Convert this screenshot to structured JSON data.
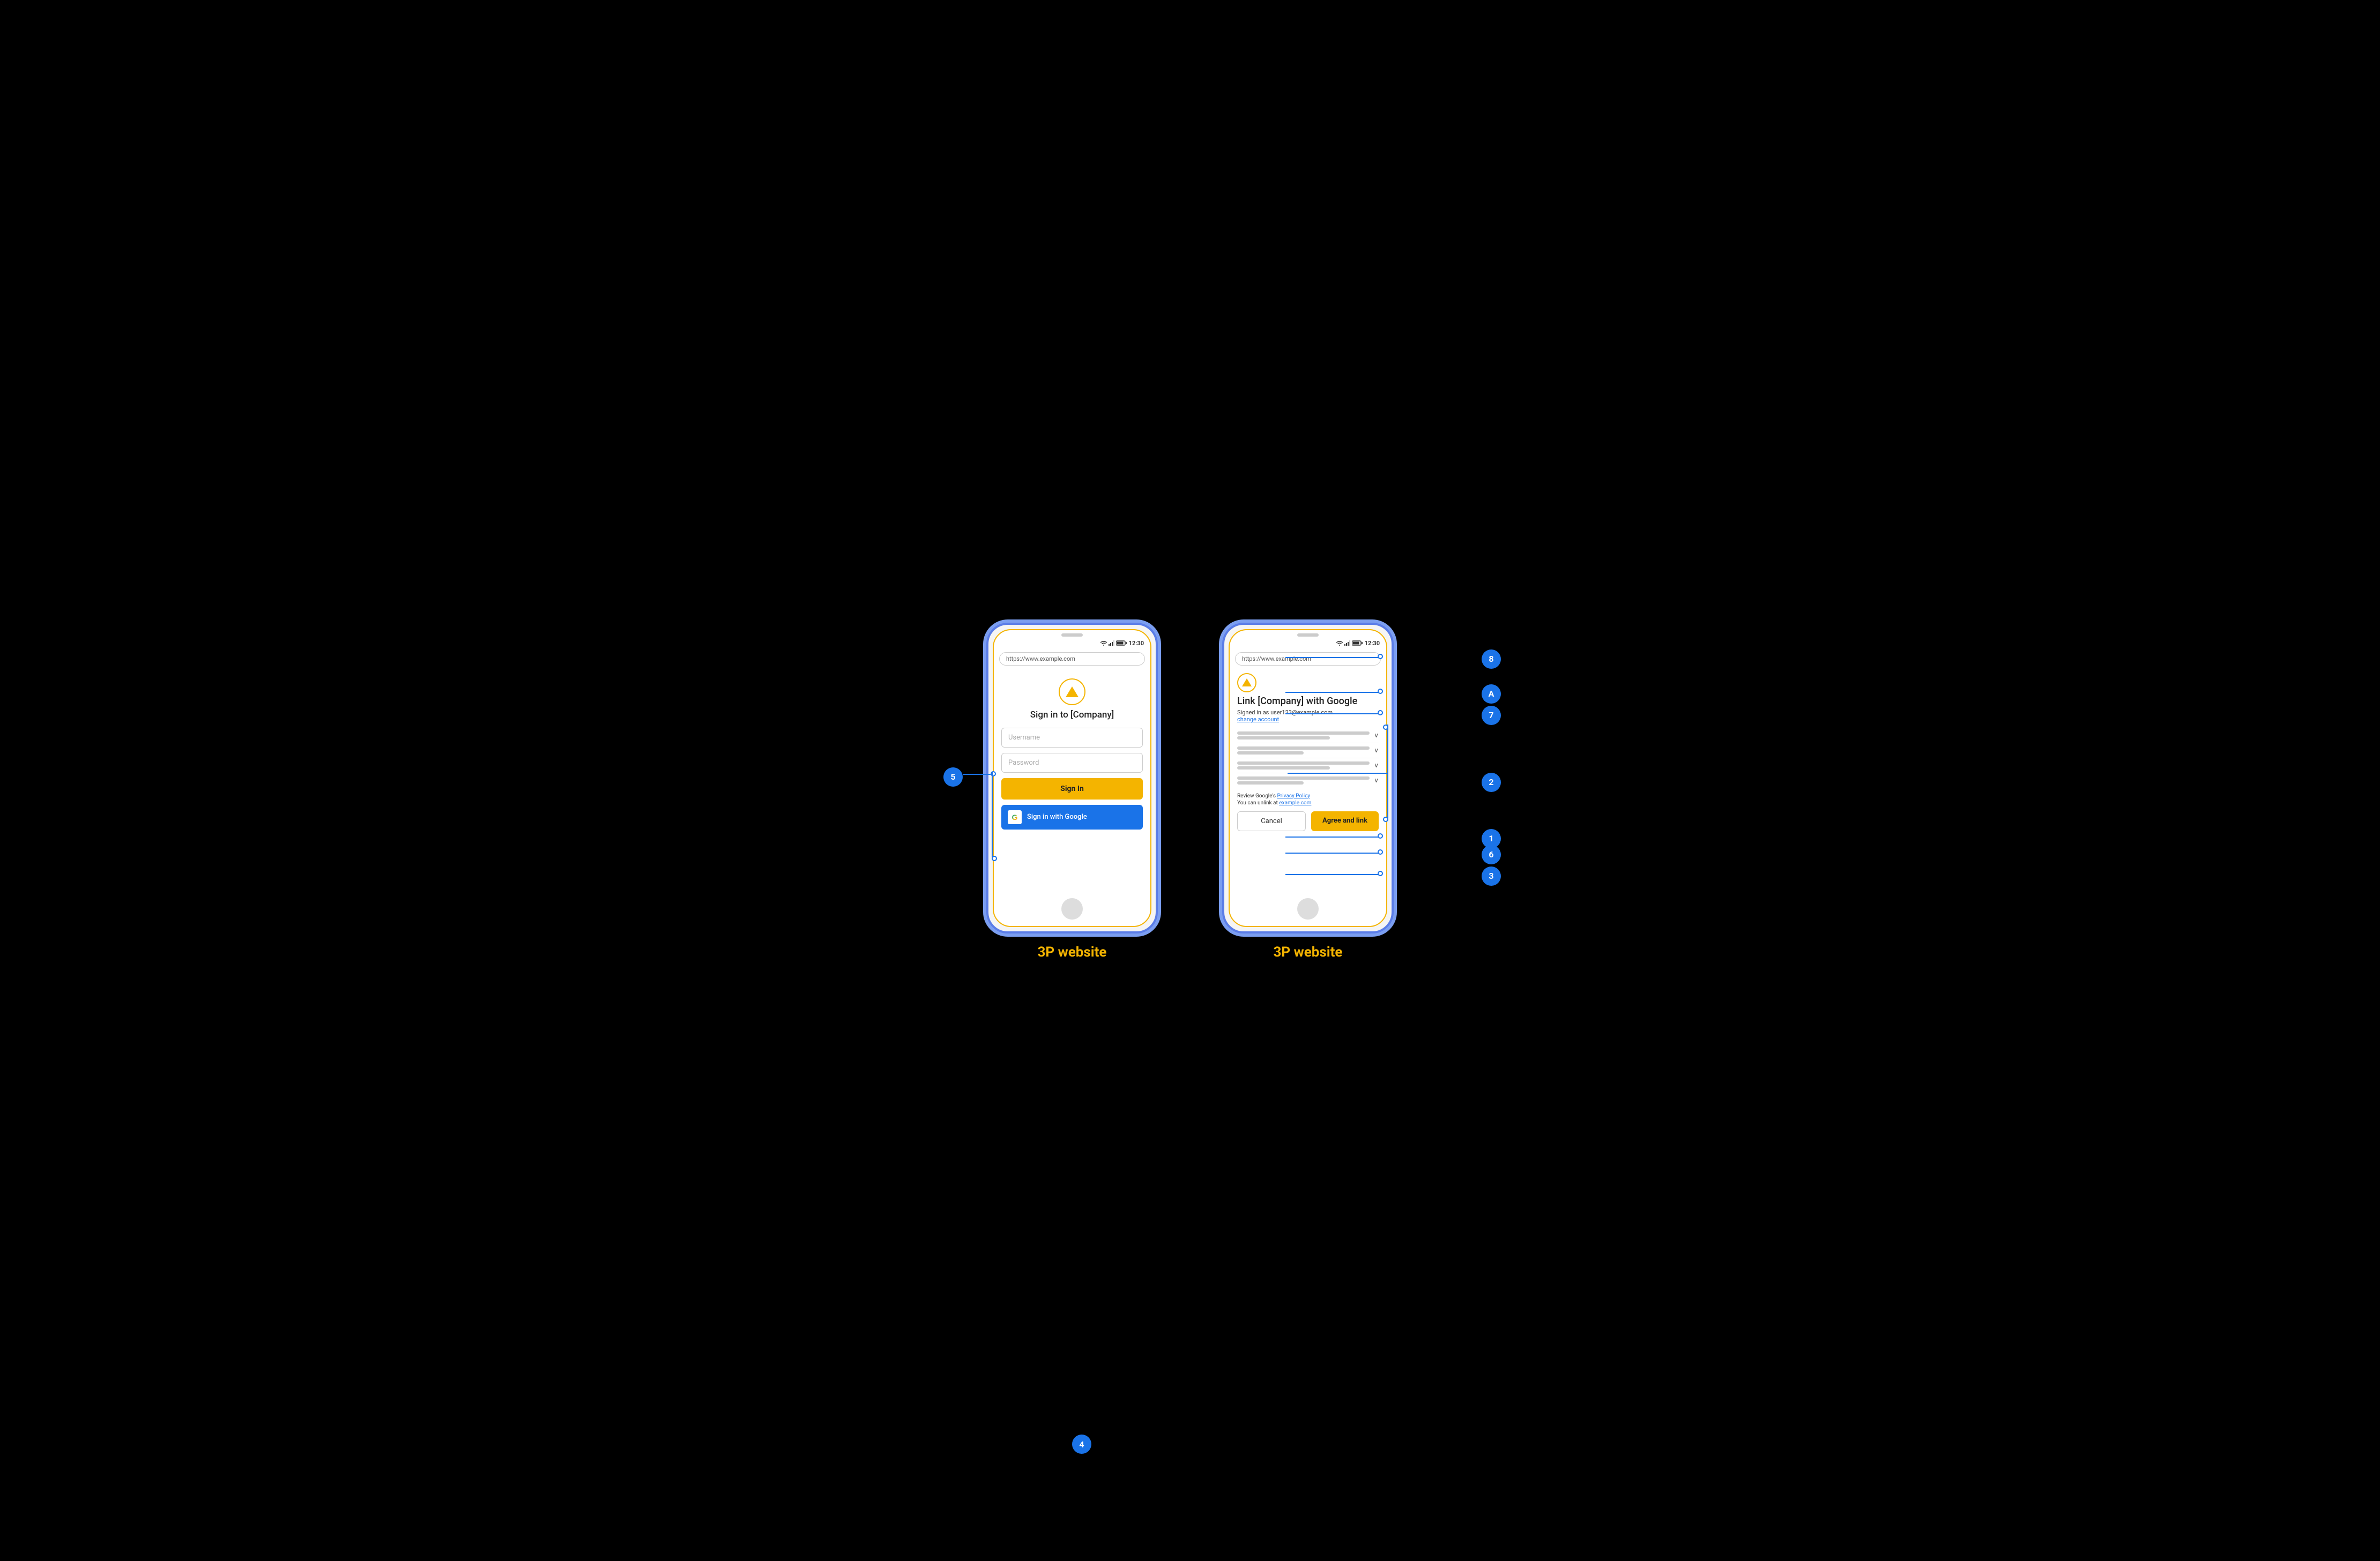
{
  "diagram": {
    "background": "#000000",
    "phone1": {
      "label": "3P website",
      "status_bar": {
        "time": "12:30"
      },
      "url": "https://www.example.com",
      "title": "Sign in to [Company]",
      "username_placeholder": "Username",
      "password_placeholder": "Password",
      "sign_in_label": "Sign In",
      "google_sign_in_label": "Sign in with Google",
      "annotation_number": "5"
    },
    "phone2": {
      "label": "3P website",
      "status_bar": {
        "time": "12:30"
      },
      "url": "https://www.example.com",
      "link_title": "Link [Company] with Google",
      "signed_in_text": "Signed in as user123@example.com",
      "change_account_label": "change account",
      "privacy_text_prefix": "Review Google's ",
      "privacy_link_label": "Privacy Policy",
      "unlink_text_prefix": "You can unlink at ",
      "unlink_link_label": "example.com",
      "cancel_label": "Cancel",
      "agree_label": "Agree and link"
    },
    "annotations": {
      "left_phone": {
        "number": "5"
      },
      "right_phone": {
        "labels": [
          "8",
          "A",
          "7",
          "2",
          "1",
          "6",
          "3"
        ],
        "numbers": [
          "8",
          "A",
          "7",
          "2",
          "1",
          "6",
          "3"
        ]
      }
    }
  }
}
